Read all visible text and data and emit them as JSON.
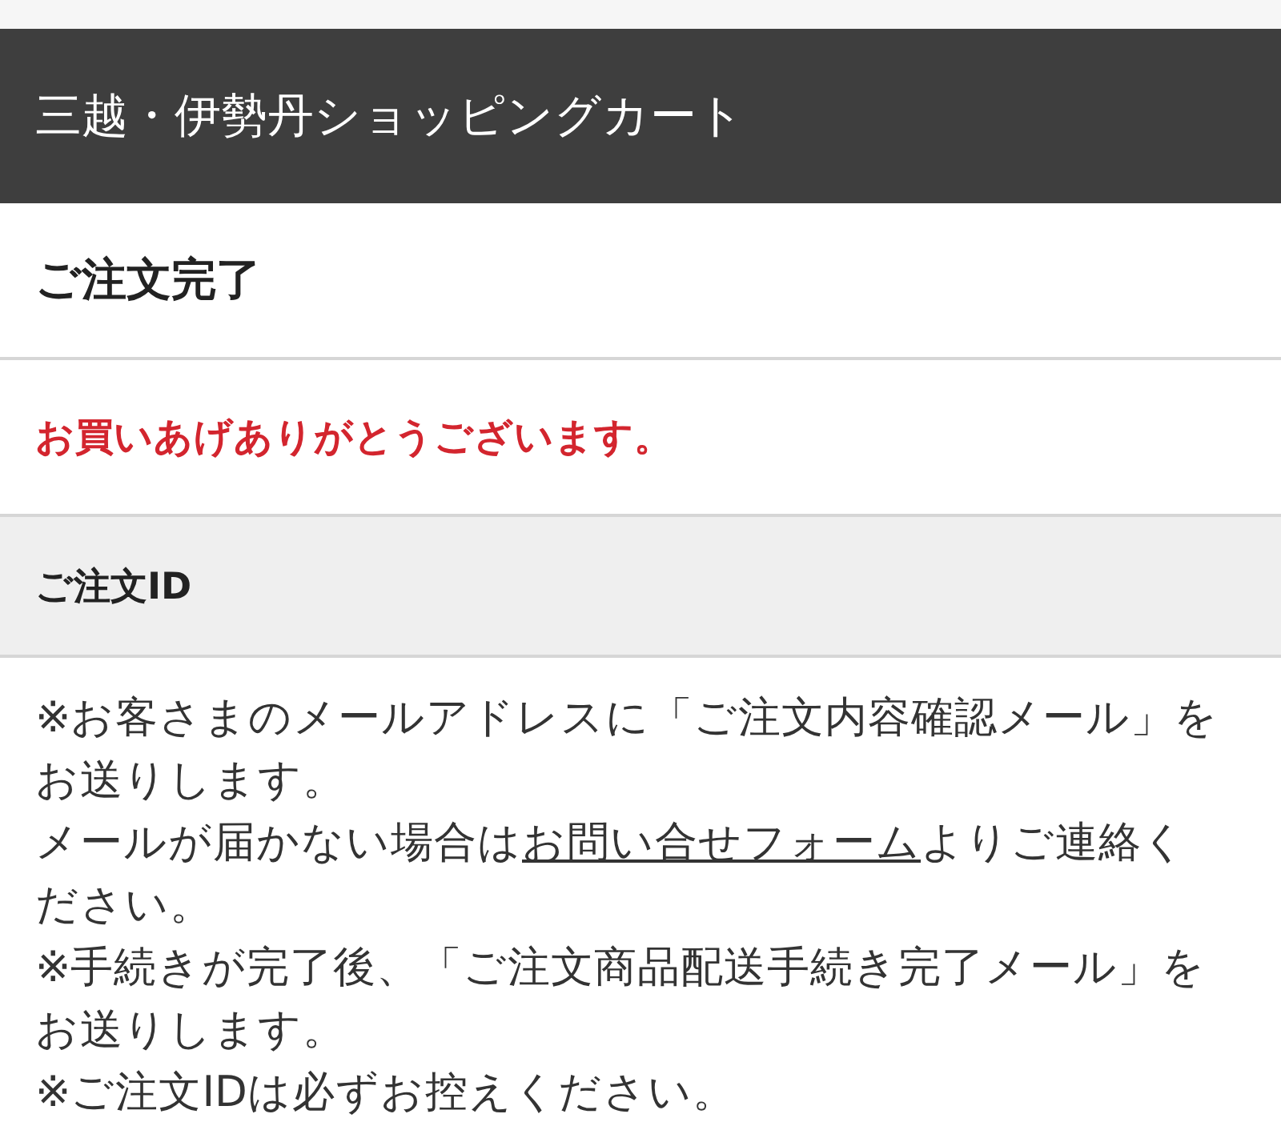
{
  "header": {
    "title": "三越・伊勢丹ショッピングカート"
  },
  "page_title": "ご注文完了",
  "thanks_message": "お買いあげありがとうございます。",
  "order_id": {
    "label": "ご注文ID"
  },
  "notes": [
    {
      "kind": "text",
      "text": "※お客さまのメールアドレスに「ご注文内容確認メール」をお送りします。"
    },
    {
      "kind": "link",
      "before": "メールが届かない場合は",
      "link": "お問い合せフォーム",
      "after": "よりご連絡ください。"
    },
    {
      "kind": "text",
      "text": "※手続きが完了後、「ご注文商品配送手続き完了メール」をお送りします。"
    },
    {
      "kind": "text",
      "text": "※ご注文IDは必ずお控えください。"
    }
  ]
}
